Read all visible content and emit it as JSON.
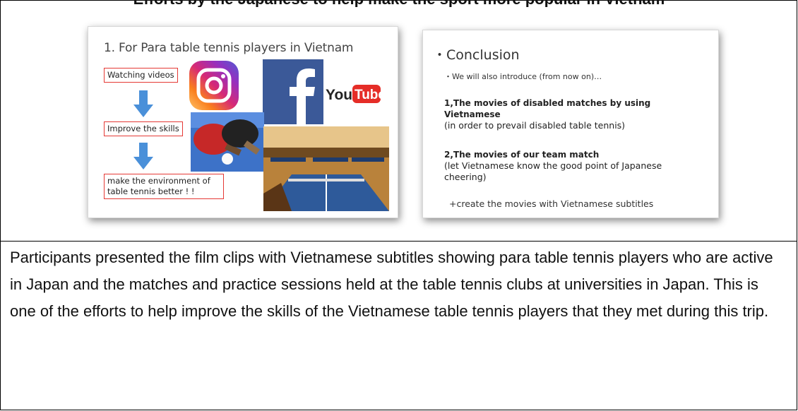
{
  "heading": "Efforts by the Japanese to help make the sport more popular in Vietnam",
  "slide_left": {
    "title": "1. For Para table tennis players in Vietnam",
    "steps": [
      "Watching videos",
      "Improve the skills",
      "make the environment of",
      "table tennis better ! !"
    ],
    "logos": [
      "instagram-logo",
      "facebook-logo",
      "youtube-logo"
    ],
    "youtube_you": "You",
    "youtube_tube": "Tube",
    "facebook_letter": "f",
    "accent_color": "#e53935",
    "arrow_color": "#4a90d9"
  },
  "slide_right": {
    "heading": "・Conclusion",
    "intro": "・We will also introduce (from now on)…",
    "item1_bold": "1,The movies of disabled matches by using Vietnamese",
    "item1_note": "(in order to prevail disabled table tennis)",
    "item2_bold": "2,The movies of our team match",
    "item2_note": "(let Vietnamese know the good point of Japanese cheering)",
    "footer": "+create the movies with Vietnamese subtitles"
  },
  "caption": "Participants presented the film clips with Vietnamese subtitles showing para table tennis players who are active in Japan and the matches and practice sessions held at the table tennis clubs at universities in Japan. This is one of the efforts to help improve the skills of the Vietnamese table tennis players that they met during this trip."
}
